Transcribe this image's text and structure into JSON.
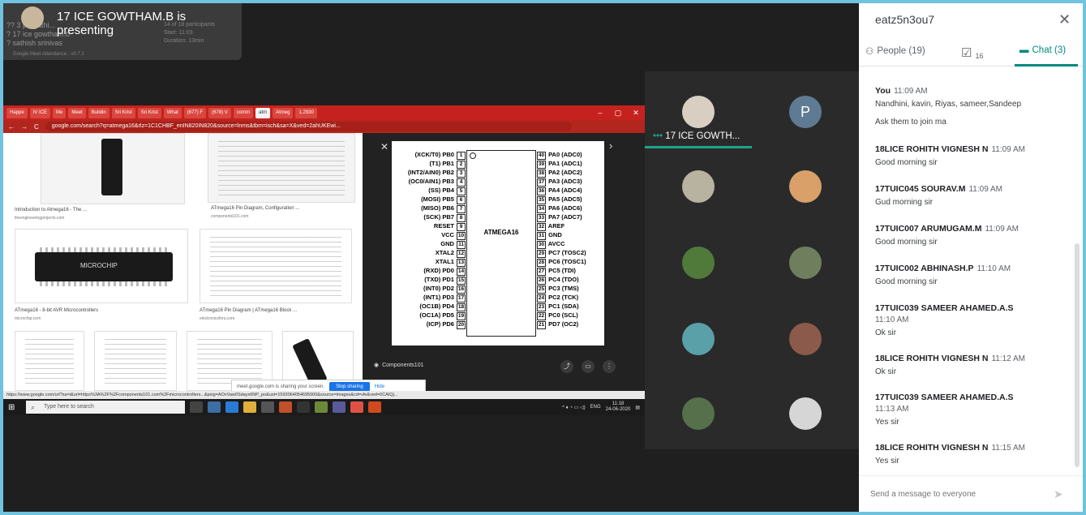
{
  "presenter": {
    "title": "17 ICE GOWTHAM.B is presenting",
    "attendance_lines": [
      "?? 3 pragathi...",
      "? 17 ice gowtham.b",
      "? sathish srinivas"
    ],
    "attendance_stats": [
      "14 of 18 participants",
      "Start: 11:03",
      "Duration: 13min"
    ],
    "footer": "Google Meet Attendance - v0.7.1"
  },
  "shared_screen": {
    "tabs": [
      "Happe",
      "IV ICE",
      "Me",
      "Meet",
      "Buildin",
      "Sri Krist",
      "Sri Krist",
      "What",
      "(677) F",
      "(678) V",
      "comm",
      "atm",
      "Atmeg",
      "1.2930"
    ],
    "url": "google.com/search?q=atmega16&rlz=1C1CHBF_enIN820IN820&source=lnms&tbm=isch&sa=X&ved=2ahUKEwi...",
    "results": [
      {
        "caption": "Introduction to Atmega16 - The ...",
        "source": "theengineeringprojects.com"
      },
      {
        "caption": "ATmega16 Pin Diagram, Configuration ...",
        "source": "components101.com"
      },
      {
        "caption": "ATmega16 - 8-bit AVR Microcontrollers",
        "source": "microchip.com"
      },
      {
        "caption": "ATmega16 Pin Diagram | ATmega16 Block ...",
        "source": "electronicsforu.com"
      }
    ],
    "chip_brand": "MICROCHIP",
    "chip_name": "ATMEGA16",
    "pins_left": [
      {
        "name": "(XCK/T0) PB0",
        "num": "1"
      },
      {
        "name": "(T1) PB1",
        "num": "2"
      },
      {
        "name": "(INT2/AIN0) PB2",
        "num": "3"
      },
      {
        "name": "(OC0/AIN1) PB3",
        "num": "4"
      },
      {
        "name": "(SS) PB4",
        "num": "5"
      },
      {
        "name": "(MOSI) PB5",
        "num": "6"
      },
      {
        "name": "(MISO) PB6",
        "num": "7"
      },
      {
        "name": "(SCK) PB7",
        "num": "8"
      },
      {
        "name": "RESET",
        "num": "9"
      },
      {
        "name": "VCC",
        "num": "10"
      },
      {
        "name": "GND",
        "num": "11"
      },
      {
        "name": "XTAL2",
        "num": "12"
      },
      {
        "name": "XTAL1",
        "num": "13"
      },
      {
        "name": "(RXD) PD0",
        "num": "14"
      },
      {
        "name": "(TXD) PD1",
        "num": "15"
      },
      {
        "name": "(INT0) PD2",
        "num": "16"
      },
      {
        "name": "(INT1) PD3",
        "num": "17"
      },
      {
        "name": "(OC1B) PD4",
        "num": "18"
      },
      {
        "name": "(OC1A) PD5",
        "num": "19"
      },
      {
        "name": "(ICP) PD6",
        "num": "20"
      }
    ],
    "pins_right": [
      {
        "num": "40",
        "name": "PA0 (ADC0)"
      },
      {
        "num": "39",
        "name": "PA1 (ADC1)"
      },
      {
        "num": "38",
        "name": "PA2 (ADC2)"
      },
      {
        "num": "37",
        "name": "PA3 (ADC3)"
      },
      {
        "num": "36",
        "name": "PA4 (ADC4)"
      },
      {
        "num": "35",
        "name": "PA5 (ADC5)"
      },
      {
        "num": "34",
        "name": "PA6 (ADC6)"
      },
      {
        "num": "33",
        "name": "PA7 (ADC7)"
      },
      {
        "num": "32",
        "name": "AREF"
      },
      {
        "num": "31",
        "name": "GND"
      },
      {
        "num": "30",
        "name": "AVCC"
      },
      {
        "num": "29",
        "name": "PC7 (TOSC2)"
      },
      {
        "num": "28",
        "name": "PC6 (TOSC1)"
      },
      {
        "num": "27",
        "name": "PC5 (TDI)"
      },
      {
        "num": "26",
        "name": "PC4 (TDO)"
      },
      {
        "num": "25",
        "name": "PC3 (TMS)"
      },
      {
        "num": "24",
        "name": "PC2 (TCK)"
      },
      {
        "num": "23",
        "name": "PC1 (SDA)"
      },
      {
        "num": "22",
        "name": "PC0 (SCL)"
      },
      {
        "num": "21",
        "name": "PD7 (OC2)"
      }
    ],
    "viewer_source": "Components101",
    "share_text": "meet.google.com is sharing your screen.",
    "stop_sharing": "Stop sharing",
    "hide": "Hide",
    "status_url": "https://www.google.com/url?sa=i&url=https%3A%2F%2Fcomponents101.com%2Fmicrocontrollers...&psig=AOvVaw0Sdayx6NP_po&ust=1593064054695000&source=images&cd=vfe&ved=0CAIQj...",
    "taskbar_search": "Type here to search",
    "tray_lang": "ENG",
    "clock_time": "11:18",
    "clock_date": "24-06-2020"
  },
  "grid": {
    "presenter_name": "17 ICE GOWTH...",
    "p_initial": "P"
  },
  "panel": {
    "meeting_code": "eatz5n3ou7",
    "tabs": {
      "people": "People (19)",
      "tasks_count": "16",
      "chat": "Chat (3)"
    },
    "messages": [
      {
        "sender": "You",
        "time": "11:09 AM",
        "texts": [
          "Nandhini, kavin, Riyas, sameer,Sandeep",
          "Ask them to join ma"
        ]
      },
      {
        "sender": "18LICE ROHITH VIGNESH N",
        "time": "11:09 AM",
        "texts": [
          "Good morning sir"
        ]
      },
      {
        "sender": "17TUIC045 SOURAV.M",
        "time": "11:09 AM",
        "texts": [
          "Gud morning sir"
        ]
      },
      {
        "sender": "17TUIC007 ARUMUGAM.M",
        "time": "11:09 AM",
        "texts": [
          "Good morning sir"
        ]
      },
      {
        "sender": "17TUIC002 ABHINASH.P",
        "time": "11:10 AM",
        "texts": [
          "Good morning sir"
        ]
      },
      {
        "sender": "17TUIC039 SAMEER AHAMED.A.S",
        "time": "11:10 AM",
        "texts": [
          "Ok sir"
        ]
      },
      {
        "sender": "18LICE ROHITH VIGNESH N",
        "time": "11:12 AM",
        "texts": [
          "Ok sir"
        ]
      },
      {
        "sender": "17TUIC039 SAMEER AHAMED.A.S",
        "time": "11:13 AM",
        "texts": [
          "Yes sir"
        ]
      },
      {
        "sender": "18LICE ROHITH VIGNESH N",
        "time": "11:15 AM",
        "texts": [
          "Yes sir"
        ]
      }
    ],
    "composer_placeholder": "Send a message to everyone"
  },
  "colors": {
    "accent": "#00897b",
    "tab_red": "#c5221f",
    "stop_blue": "#1a73e8",
    "border": "#6fc3df"
  }
}
